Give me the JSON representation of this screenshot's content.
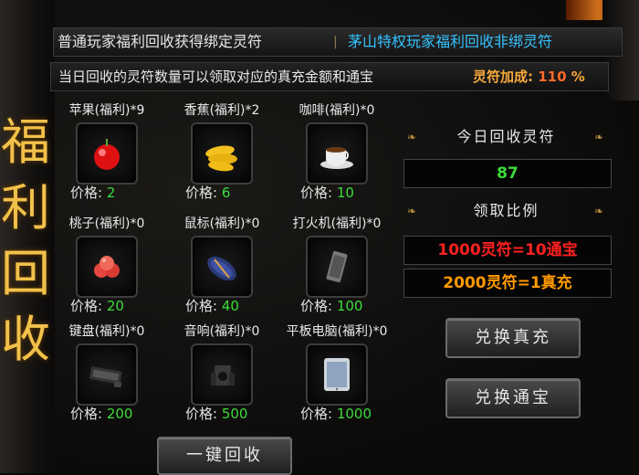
{
  "sidebar": {
    "title_chars": [
      "福",
      "利",
      "回",
      "收"
    ]
  },
  "tabs": {
    "normal": "普通玩家福利回收获得绑定灵符",
    "separator": "|",
    "privilege": "茅山特权玩家福利回收非绑灵符"
  },
  "info": {
    "text": "当日回收的灵符数量可以领取对应的真充金额和通宝",
    "bonus_label": "灵符加成:",
    "bonus_value": "110",
    "bonus_unit": "%"
  },
  "price_label": "价格:",
  "items": [
    {
      "name": "苹果(福利)*9",
      "price": "2",
      "icon": "apple-icon"
    },
    {
      "name": "香蕉(福利)*2",
      "price": "6",
      "icon": "banana-icon"
    },
    {
      "name": "咖啡(福利)*0",
      "price": "10",
      "icon": "coffee-icon"
    },
    {
      "name": "桃子(福利)*0",
      "price": "20",
      "icon": "peach-icon"
    },
    {
      "name": "鼠标(福利)*0",
      "price": "40",
      "icon": "mouse-icon"
    },
    {
      "name": "打火机(福利)*0",
      "price": "100",
      "icon": "lighter-icon"
    },
    {
      "name": "键盘(福利)*0",
      "price": "200",
      "icon": "keyboard-icon"
    },
    {
      "name": "音响(福利)*0",
      "price": "500",
      "icon": "speaker-icon"
    },
    {
      "name": "平板电脑(福利)*0",
      "price": "1000",
      "icon": "tablet-icon"
    }
  ],
  "panel": {
    "today_title": "今日回收灵符",
    "today_value": "87",
    "ratio_title": "领取比例",
    "ratio_1": "1000灵符=10通宝",
    "ratio_2": "2000灵符=1真充",
    "btn_cash": "兑换真充",
    "btn_token": "兑换通宝"
  },
  "recycle_all": "一键回收",
  "colors": {
    "ratio_1": "#ff2020",
    "ratio_2": "#ff9a00",
    "today": "#3cdc3c"
  }
}
